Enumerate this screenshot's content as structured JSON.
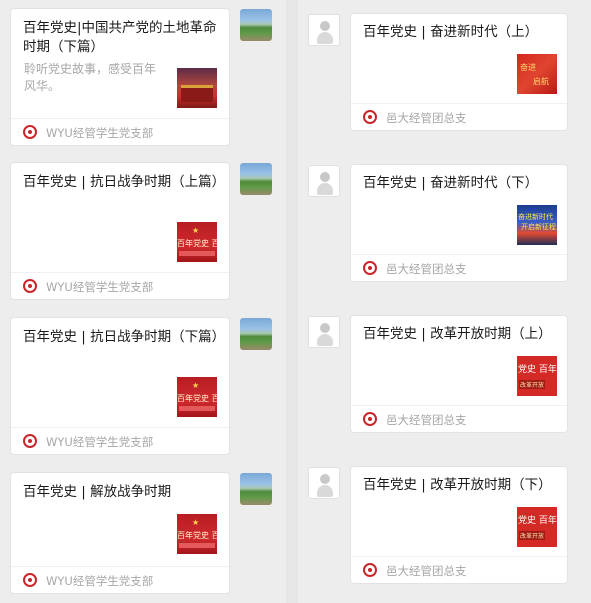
{
  "left_column": {
    "messages": [
      {
        "title": "百年党史|中国共产党的土地革命时期（下篇）",
        "digest": "聆听党史故事，感受百年风华。",
        "source": "WYU经管学生党支部",
        "thumb_icon": "tiananmen-image"
      },
      {
        "title": "百年党史 | 抗日战争时期（上篇）",
        "source": "WYU经管学生党支部",
        "thumb_icon": "party-history-poster-image",
        "thumb_text": "百年党史 百年"
      },
      {
        "title": "百年党史 | 抗日战争时期（下篇）",
        "source": "WYU经管学生党支部",
        "thumb_icon": "party-history-poster-image",
        "thumb_text": "百年党史 百年"
      },
      {
        "title": "百年党史 | 解放战争时期",
        "source": "WYU经管学生党支部",
        "thumb_icon": "party-history-poster-image",
        "thumb_text": "百年党史 百年"
      }
    ]
  },
  "right_column": {
    "messages": [
      {
        "title": "百年党史 | 奋进新时代（上）",
        "source": "邑大经管团总支",
        "thumb_icon": "new-era-poster-image"
      },
      {
        "title": "百年党史 | 奋进新时代（下）",
        "source": "邑大经管团总支",
        "thumb_icon": "new-era-banner-image"
      },
      {
        "title": "百年党史 | 改革开放时期（上）",
        "source": "邑大经管团总支",
        "thumb_icon": "reform-opening-poster-image",
        "thumb_text": "党史 百年"
      },
      {
        "title": "百年党史 | 改革开放时期（下）",
        "source": "邑大经管团总支",
        "thumb_icon": "reform-opening-poster-image",
        "thumb_text": "党史 百年"
      }
    ]
  },
  "colors": {
    "background": "#ededed",
    "card": "#ffffff",
    "title": "#191919",
    "meta": "#a6a6a6",
    "party_red": "#c9262c"
  }
}
